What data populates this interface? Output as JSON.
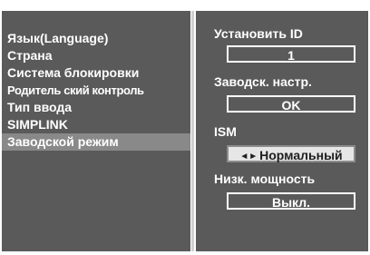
{
  "menu": {
    "items": [
      {
        "label": "Язык(Language)"
      },
      {
        "label": "Страна"
      },
      {
        "label": "Система блокировки"
      },
      {
        "label": "Родитель ский контроль"
      },
      {
        "label": "Тип ввода"
      },
      {
        "label": "SIMPLINK"
      },
      {
        "label": "Заводской режим"
      }
    ],
    "selected": "Заводской режим"
  },
  "settings": {
    "set_id": {
      "label": "Установить ID",
      "value": "1"
    },
    "factory_reset": {
      "label": "Заводск. настр.",
      "value": "OK"
    },
    "ism": {
      "label": "ISM",
      "arrows": "◄►",
      "value": "Нормальный"
    },
    "low_power": {
      "label": "Низк. мощность",
      "value": "Выкл."
    }
  },
  "colors": {
    "panel_bg": "#5a5a5a",
    "selected_row": "#898989",
    "active_box_bg": "#e6e6e6",
    "text": "#ffffff"
  }
}
